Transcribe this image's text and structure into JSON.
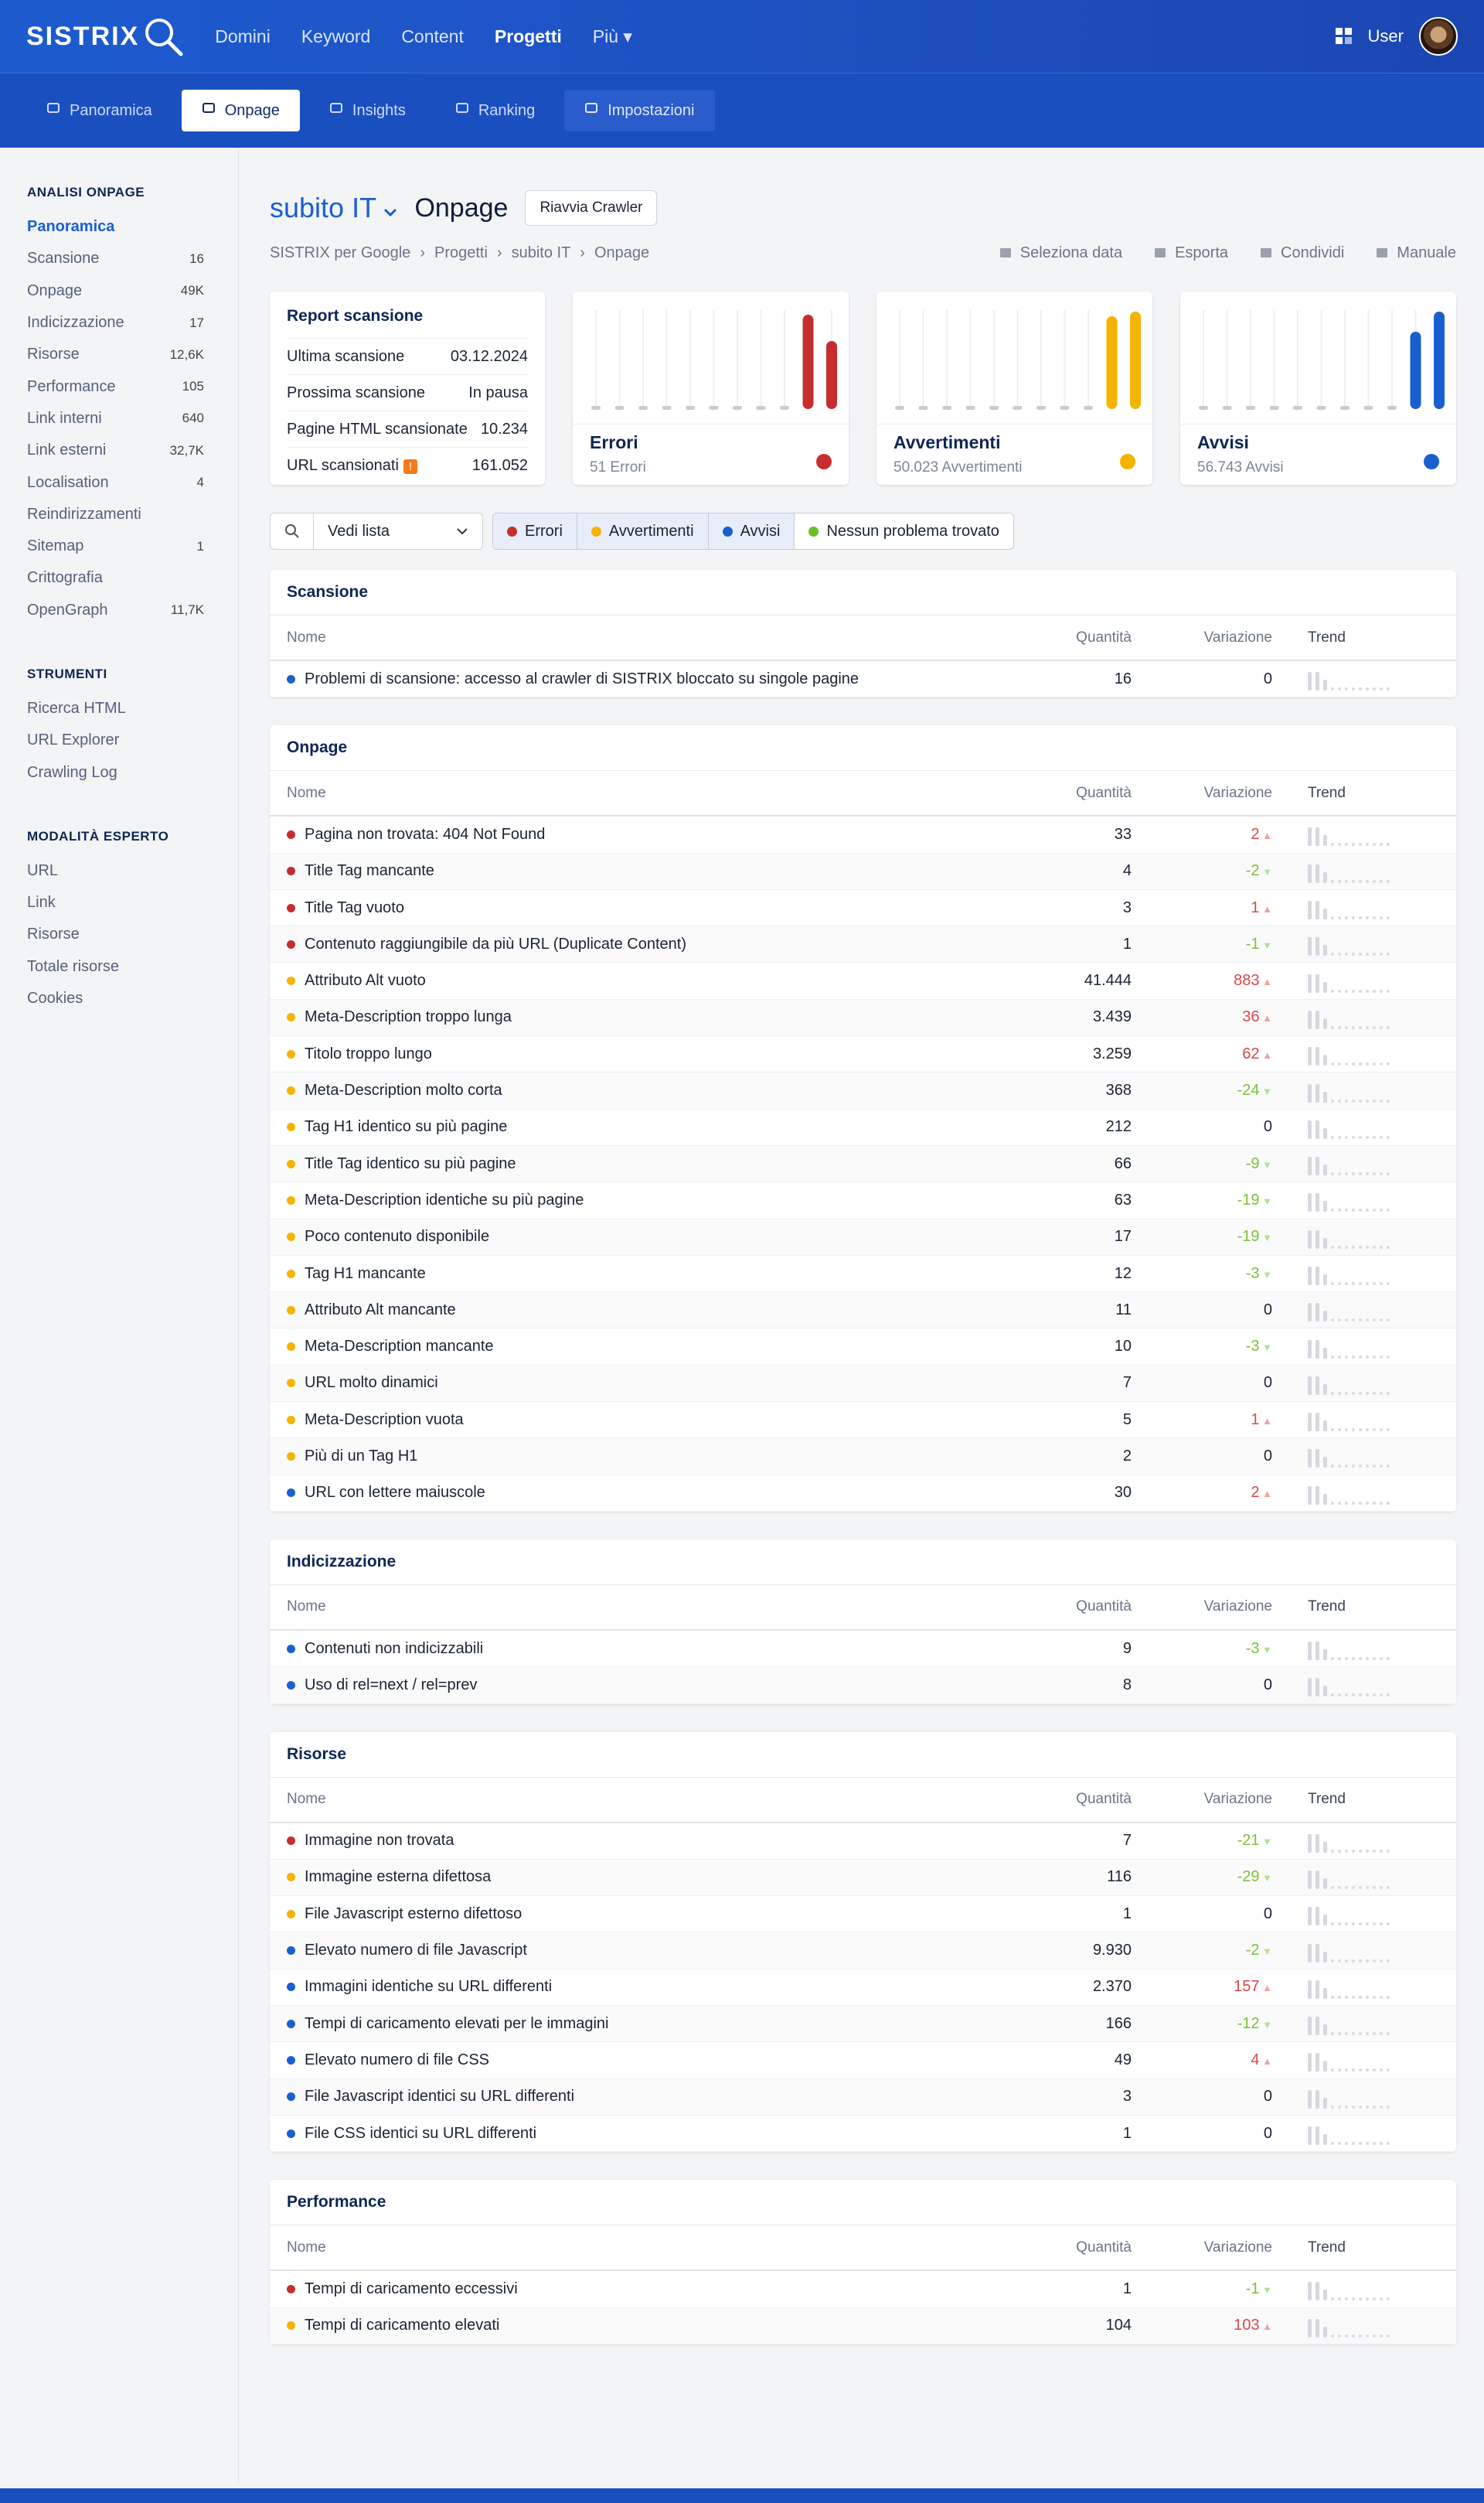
{
  "header": {
    "logo": "SISTRIX",
    "nav": [
      "Domini",
      "Keyword",
      "Content",
      "Progetti",
      "Più"
    ],
    "user": "User"
  },
  "subnav": [
    "Panoramica",
    "Onpage",
    "Insights",
    "Ranking",
    "Impostazioni"
  ],
  "sidebar": {
    "analisi_title": "ANALISI ONPAGE",
    "analisi": [
      {
        "l": "Panoramica",
        "c": ""
      },
      {
        "l": "Scansione",
        "c": "16"
      },
      {
        "l": "Onpage",
        "c": "49K"
      },
      {
        "l": "Indicizzazione",
        "c": "17"
      },
      {
        "l": "Risorse",
        "c": "12,6K"
      },
      {
        "l": "Performance",
        "c": "105"
      },
      {
        "l": "Link interni",
        "c": "640"
      },
      {
        "l": "Link esterni",
        "c": "32,7K"
      },
      {
        "l": "Localisation",
        "c": "4"
      },
      {
        "l": "Reindirizzamenti",
        "c": ""
      },
      {
        "l": "Sitemap",
        "c": "1"
      },
      {
        "l": "Crittografia",
        "c": ""
      },
      {
        "l": "OpenGraph",
        "c": "11,7K"
      }
    ],
    "strumenti_title": "STRUMENTI",
    "strumenti": [
      "Ricerca HTML",
      "URL Explorer",
      "Crawling Log"
    ],
    "esperto_title": "MODALITÀ ESPERTO",
    "esperto": [
      "URL",
      "Link",
      "Risorse",
      "Totale risorse",
      "Cookies"
    ]
  },
  "page": {
    "project": "subito IT",
    "title": "Onpage",
    "restart": "Riavvia Crawler",
    "breadcrumb": [
      "SISTRIX per Google",
      "Progetti",
      "subito IT",
      "Onpage"
    ],
    "actions": [
      "Seleziona data",
      "Esporta",
      "Condividi",
      "Manuale"
    ]
  },
  "report": {
    "title": "Report scansione",
    "rows": [
      [
        "Ultima scansione",
        "03.12.2024"
      ],
      [
        "Prossima scansione",
        "In pausa"
      ],
      [
        "Pagine HTML scansionate",
        "10.234"
      ],
      [
        "URL scansionati",
        "161.052"
      ]
    ],
    "badge": "!"
  },
  "summary": [
    {
      "title": "Errori",
      "sub": "51 Errori",
      "color": "#c62e2e"
    },
    {
      "title": "Avvertimenti",
      "sub": "50.023 Avvertimenti",
      "color": "#f5b400"
    },
    {
      "title": "Avvisi",
      "sub": "56.743 Avvisi",
      "color": "#1a5fd0"
    }
  ],
  "filters": {
    "view": "Vedi lista",
    "chips": [
      "Errori",
      "Avvertimenti",
      "Avvisi",
      "Nessun problema trovato"
    ]
  },
  "cols": {
    "name": "Nome",
    "qty": "Quantità",
    "var": "Variazione",
    "trend": "Trend"
  },
  "sections": [
    {
      "title": "Scansione",
      "rows": [
        [
          "b",
          "Problemi di scansione: accesso al crawler di SISTRIX bloccato su singole pagine",
          "16",
          "0",
          ""
        ]
      ]
    },
    {
      "title": "Onpage",
      "rows": [
        [
          "r",
          "Pagina non trovata: 404 Not Found",
          "33",
          "2",
          "u"
        ],
        [
          "r",
          "Title Tag mancante",
          "4",
          "-2",
          "d"
        ],
        [
          "r",
          "Title Tag vuoto",
          "3",
          "1",
          "u"
        ],
        [
          "r",
          "Contenuto raggiungibile da più URL (Duplicate Content)",
          "1",
          "-1",
          "d"
        ],
        [
          "y",
          "Attributo Alt vuoto",
          "41.444",
          "883",
          "u"
        ],
        [
          "y",
          "Meta-Description troppo lunga",
          "3.439",
          "36",
          "u"
        ],
        [
          "y",
          "Titolo troppo lungo",
          "3.259",
          "62",
          "u"
        ],
        [
          "y",
          "Meta-Description molto corta",
          "368",
          "-24",
          "d"
        ],
        [
          "y",
          "Tag H1 identico su più pagine",
          "212",
          "0",
          ""
        ],
        [
          "y",
          "Title Tag identico su più pagine",
          "66",
          "-9",
          "d"
        ],
        [
          "y",
          "Meta-Description identiche su più pagine",
          "63",
          "-19",
          "d"
        ],
        [
          "y",
          "Poco contenuto disponibile",
          "17",
          "-19",
          "d"
        ],
        [
          "y",
          "Tag H1 mancante",
          "12",
          "-3",
          "d"
        ],
        [
          "y",
          "Attributo Alt mancante",
          "11",
          "0",
          ""
        ],
        [
          "y",
          "Meta-Description mancante",
          "10",
          "-3",
          "d"
        ],
        [
          "y",
          "URL molto dinamici",
          "7",
          "0",
          ""
        ],
        [
          "y",
          "Meta-Description vuota",
          "5",
          "1",
          "u"
        ],
        [
          "y",
          "Più di un Tag H1",
          "2",
          "0",
          ""
        ],
        [
          "b",
          "URL con lettere maiuscole",
          "30",
          "2",
          "u"
        ]
      ]
    },
    {
      "title": "Indicizzazione",
      "rows": [
        [
          "b",
          "Contenuti non indicizzabili",
          "9",
          "-3",
          "d"
        ],
        [
          "b",
          "Uso di rel=next / rel=prev",
          "8",
          "0",
          ""
        ]
      ]
    },
    {
      "title": "Risorse",
      "rows": [
        [
          "r",
          "Immagine non trovata",
          "7",
          "-21",
          "d"
        ],
        [
          "y",
          "Immagine esterna difettosa",
          "116",
          "-29",
          "d"
        ],
        [
          "y",
          "File Javascript esterno difettoso",
          "1",
          "0",
          ""
        ],
        [
          "b",
          "Elevato numero di file Javascript",
          "9.930",
          "-2",
          "d"
        ],
        [
          "b",
          "Immagini identiche su URL differenti",
          "2.370",
          "157",
          "u"
        ],
        [
          "b",
          "Tempi di caricamento elevati per le immagini",
          "166",
          "-12",
          "d"
        ],
        [
          "b",
          "Elevato numero di file CSS",
          "49",
          "4",
          "u"
        ],
        [
          "b",
          "File Javascript identici su URL differenti",
          "3",
          "0",
          ""
        ],
        [
          "b",
          "File CSS identici su URL differenti",
          "1",
          "0",
          ""
        ]
      ]
    },
    {
      "title": "Performance",
      "rows": [
        [
          "r",
          "Tempi di caricamento eccessivi",
          "1",
          "-1",
          "d"
        ],
        [
          "y",
          "Tempi di caricamento elevati",
          "104",
          "103",
          "u"
        ]
      ]
    }
  ]
}
